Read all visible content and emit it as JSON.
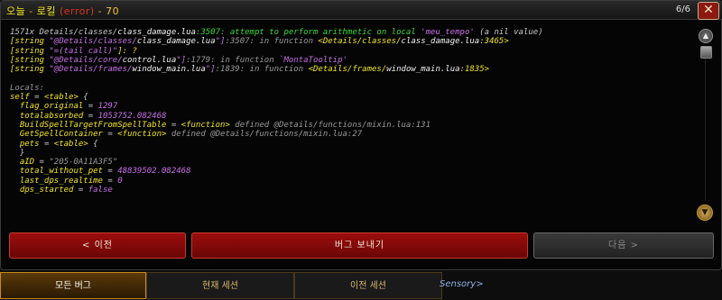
{
  "window": {
    "title_prefix": "오늘",
    "title_sep1": " - ",
    "title_label": "로킬",
    "title_error": " (error)",
    "title_sep2": " - ",
    "title_count": "70",
    "page_indicator": "6/6",
    "close_icon": "✕"
  },
  "log": {
    "line1_a": "1571x Details/classes/",
    "line1_b": "class_damage.lua",
    "line1_c": ":3507: attempt to perform arithmetic on local ",
    "line1_d": "'meu_tempo'",
    "line1_e": " (a nil value)",
    "line2_a": "[string ",
    "line2_b": "\"@Details/classes/",
    "line2_c": "class_damage.lua",
    "line2_d": "\"]",
    "line2_e": ":3507: in function ",
    "line2_f": "<Details/classes/",
    "line2_g": "class_damage.lua",
    "line2_h": ":3465>",
    "line3_a": "[string ",
    "line3_b": "\"=(tail call)\"",
    "line3_c": "]: ?",
    "line4_a": "[string ",
    "line4_b": "\"@Details/core/",
    "line4_c": "control.lua",
    "line4_d": "\"]",
    "line4_e": ":1779: in function ",
    "line4_f": "`MontaTooltip'",
    "line5_a": "[string ",
    "line5_b": "\"@Details/frames/",
    "line5_c": "window_main.lua",
    "line5_d": "\"]",
    "line5_e": ":1839: in function ",
    "line5_f": "<Details/frames/",
    "line5_g": "window_main.lua",
    "line5_h": ":1835>",
    "locals_header": "Locals:",
    "self_a": "self",
    "self_b": " = ",
    "self_c": "<table>",
    "self_d": " {",
    "l1_k": "flag_original",
    "l1_v": "1297",
    "l2_k": "totalabsorbed",
    "l2_v": "1053752.082468",
    "l3_k": "BuildSpellTargetFromSpellTable",
    "l3_v": "<function>",
    "l3_d": " defined @Details/functions/mixin.lua:131",
    "l4_k": "GetSpellContainer",
    "l4_v": "<function>",
    "l4_d": " defined @Details/functions/mixin.lua:27",
    "l5_k": "pets",
    "l5_v": "<table>",
    "l5_e": " {",
    "l6": "}",
    "l7_k": "aID",
    "l7_v": "\"205-0A11A3F5\"",
    "l8_k": "total_without_pet",
    "l8_v": "48839502.082468",
    "l9_k": "last_dps_realtime",
    "l9_v": "0",
    "l10_k": "dps_started",
    "l10_v": "false",
    "eq": " = "
  },
  "buttons": {
    "prev": "< 이전",
    "report": "버그 보내기",
    "next": "다음 >"
  },
  "tabs": {
    "all": "모든 버그",
    "current": "현재 세션",
    "previous": "이전 세션"
  },
  "behind_text": "Sensory>"
}
